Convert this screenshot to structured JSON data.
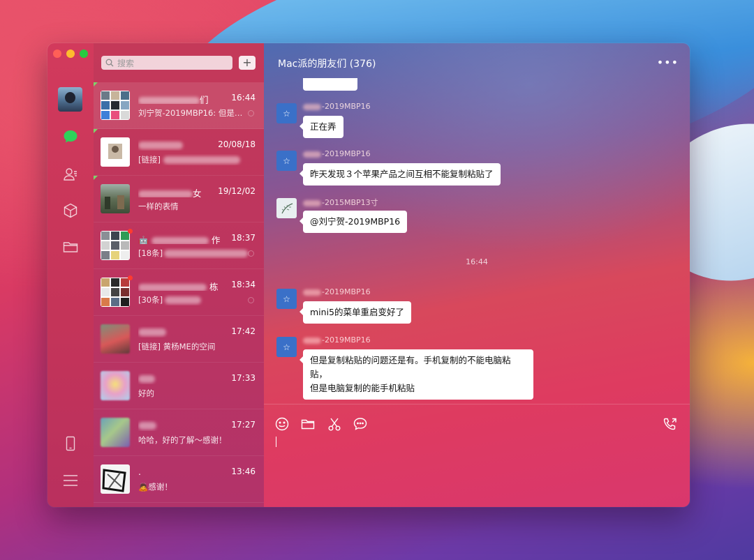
{
  "window": {
    "title": "Mac派的朋友们 (376)"
  },
  "search": {
    "placeholder": "搜索"
  },
  "add_label": "+",
  "conversations": [
    {
      "name_suffix": "们",
      "time": "16:44",
      "preview": "刘宁贺-2019MBP16: 但是…",
      "pinned": true,
      "unread": false
    },
    {
      "name_suffix": "",
      "time": "20/08/18",
      "preview": "[链接]",
      "pinned": true,
      "unread": false
    },
    {
      "name_suffix": "女",
      "time": "19/12/02",
      "preview": "一样的表情",
      "pinned": true,
      "unread": false
    },
    {
      "name_suffix": "作",
      "time": "18:37",
      "preview": "[18条]",
      "pinned": false,
      "unread": true
    },
    {
      "name_suffix": "栋",
      "time": "18:34",
      "preview": "[30条]",
      "pinned": false,
      "unread": true
    },
    {
      "name_suffix": "",
      "time": "17:42",
      "preview": "[链接] 黄杨ME的空间",
      "pinned": false,
      "unread": false
    },
    {
      "name_suffix": "",
      "time": "17:33",
      "preview": "好的",
      "pinned": false,
      "unread": false
    },
    {
      "name_suffix": "",
      "time": "17:27",
      "preview": "哈哈，好的了解～感谢！",
      "pinned": false,
      "unread": false
    },
    {
      "name_suffix": ".",
      "time": "13:46",
      "preview": "感谢！",
      "pinned": false,
      "unread": false
    }
  ],
  "messages": [
    {
      "sender": "-2019MBP16",
      "text": "正在弄"
    },
    {
      "sender": "-2019MBP16",
      "text": "昨天发现３个苹果产品之间互相不能复制粘贴了"
    },
    {
      "sender": "-2015MBP13寸",
      "text": "@刘宁贺-2019MBP16"
    },
    {
      "sender": "-2019MBP16",
      "text": "mini5的菜单重启变好了"
    },
    {
      "sender": "-2019MBP16",
      "text": "但是复制粘贴的问题还是有。手机复制的不能电脑粘贴，",
      "text2": "但是电脑复制的能手机粘贴"
    }
  ],
  "timestamp": "16:44",
  "icons": {
    "rail": [
      "chat-bubble-icon",
      "contacts-icon",
      "cube-icon",
      "folder-icon",
      "phone-icon",
      "menu-icon"
    ],
    "composer": [
      "emoji-icon",
      "folder-icon",
      "scissors-icon",
      "message-icon",
      "voice-call-icon"
    ]
  },
  "colors": {
    "accent_green": "#2fd15a",
    "unread_dot": "#ff3b30",
    "pin_green": "#7fd36b"
  }
}
